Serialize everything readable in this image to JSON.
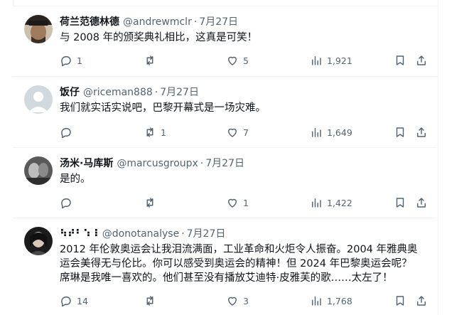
{
  "tweets": [
    {
      "name": "荷兰范德林德",
      "handle": "@andrewmclr",
      "date": "7月27日",
      "text": "与 2008 年的颁奖典礼相比，这真是可笑！",
      "replies": "1",
      "retweets": "",
      "likes": "5",
      "views": "1,921",
      "avatar_color": "#6b5a4a"
    },
    {
      "name": "饭仔",
      "handle": "@riceman888",
      "date": "7月27日",
      "text": "我们就实话实说吧，巴黎开幕式是一场灾难。",
      "replies": "",
      "retweets": "1",
      "likes": "7",
      "views": "1,649",
      "avatar_color": "#c9d3db"
    },
    {
      "name": "汤米·马库斯",
      "handle": "@marcusgroupx",
      "date": "7月27日",
      "text": "是的。",
      "replies": "",
      "retweets": "",
      "likes": "1",
      "views": "1,422",
      "avatar_color": "#3a3a3a"
    },
    {
      "name": "⠳⠞⠃⠱⠸",
      "handle": "@donotanalyse",
      "date": "7月27日",
      "text_lines": [
        "2012 年伦敦奥运会让我泪流满面，工业革命和火炬令人振奋。2004 年雅典奥",
        "运会美得无与伦比。你可以感受到奥运会的精神！但 2024 年巴黎奥运会呢？",
        "席琳是我唯一喜欢的。他们甚至没有播放艾迪特·皮雅芙的歌……太左了！"
      ],
      "replies": "14",
      "retweets": "",
      "likes": "3",
      "views": "1,768",
      "avatar_color": "#2b2b2b"
    }
  ],
  "icons": {
    "reply": "reply-icon",
    "retweet": "retweet-icon",
    "like": "heart-icon",
    "views": "views-chart-icon",
    "bookmark": "bookmark-icon",
    "share": "share-icon"
  },
  "colors": {
    "text": "#0f1419",
    "secondary": "#536471",
    "border": "#eff3f4"
  }
}
